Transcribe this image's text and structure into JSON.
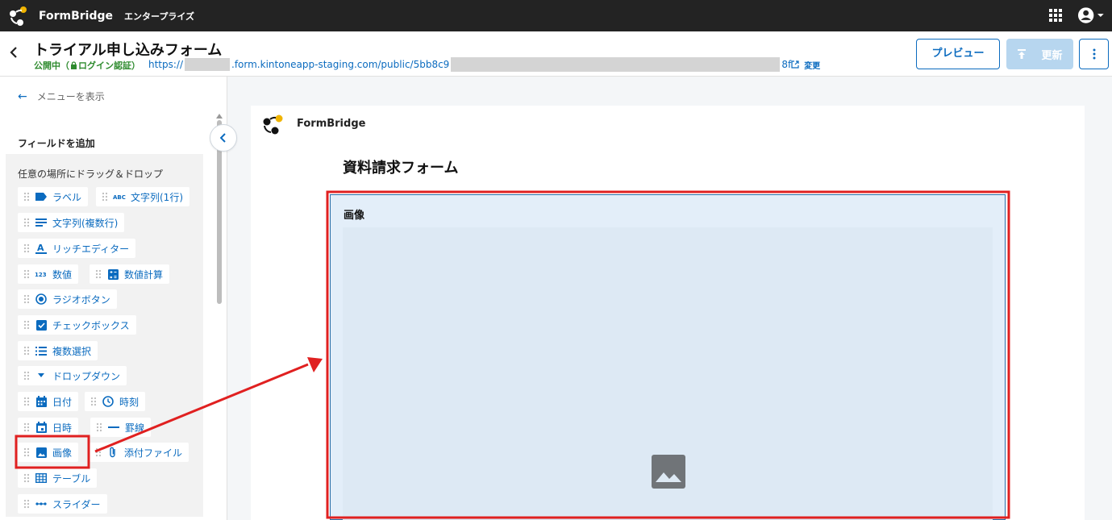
{
  "app": {
    "brand": "FormBridge",
    "edition": "エンタープライズ"
  },
  "header": {
    "title": "トライアル申し込みフォーム",
    "status_public": "公開中（",
    "status_auth": "ログイン認証）",
    "url_prefix": "https://",
    "url_middle": ".form.kintoneapp-staging.com/public/5bb8c9",
    "url_suffix": "8f",
    "change_label": "変更",
    "preview_label": "プレビュー",
    "update_label": "更新"
  },
  "sidebar": {
    "show_menu": "メニューを表示",
    "add_field_title": "フィールドを追加",
    "drag_hint": "任意の場所にドラッグ＆ドロップ",
    "fields": [
      {
        "label": "ラベル",
        "icon": "label-icon"
      },
      {
        "label": "文字列(1行)",
        "icon": "abc-icon"
      },
      {
        "label": "文字列(複数行)",
        "icon": "lines-icon"
      },
      {
        "label": "リッチエディター",
        "icon": "text-format-icon"
      },
      {
        "label": "数値",
        "icon": "number-icon"
      },
      {
        "label": "数値計算",
        "icon": "calculator-icon"
      },
      {
        "label": "ラジオボタン",
        "icon": "radio-icon"
      },
      {
        "label": "チェックボックス",
        "icon": "checkbox-icon"
      },
      {
        "label": "複数選択",
        "icon": "list-icon"
      },
      {
        "label": "ドロップダウン",
        "icon": "dropdown-icon"
      },
      {
        "label": "日付",
        "icon": "calendar-icon"
      },
      {
        "label": "時刻",
        "icon": "clock-icon"
      },
      {
        "label": "日時",
        "icon": "calendar-event-icon"
      },
      {
        "label": "罫線",
        "icon": "horizontal-rule-icon"
      },
      {
        "label": "画像",
        "icon": "image-icon"
      },
      {
        "label": "添付ファイル",
        "icon": "paperclip-icon"
      },
      {
        "label": "テーブル",
        "icon": "table-icon"
      },
      {
        "label": "スライダー",
        "icon": "slider-icon"
      }
    ]
  },
  "canvas": {
    "brand": "FormBridge",
    "form_title": "資料請求フォーム",
    "image_field_label": "画像"
  },
  "colors": {
    "primary": "#0b6bbf",
    "topbar": "#232323",
    "annotation": "#e02020",
    "status_green": "#2e8b2e"
  }
}
